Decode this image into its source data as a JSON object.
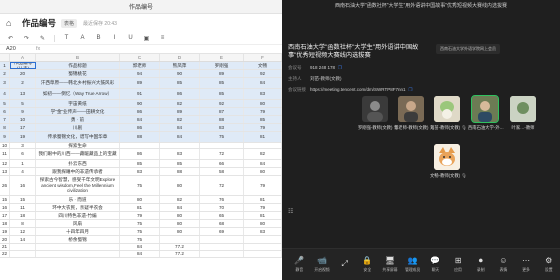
{
  "sheet": {
    "window_title": "作品编号",
    "doc_title": "作品编号",
    "doc_tag": "表格",
    "save_status": "最近保存 20:43",
    "cell_ref": "A20",
    "fx": "fx",
    "columns": [
      "",
      "A",
      "B",
      "C",
      "D",
      "E",
      "F"
    ],
    "rows": [
      {
        "n": "1",
        "a": "作品编号(从表)",
        "b": "作品标题",
        "c": "郭老师",
        "d": "熊凤萍",
        "e": "罗刚强",
        "f": "文畅",
        "h": 8,
        "sel": true,
        "hdr": true
      },
      {
        "n": "2",
        "a": "20",
        "b": "蜀锦桃花",
        "c": "94",
        "d": "90",
        "e": "89",
        "f": "92",
        "h": 8,
        "sel": true
      },
      {
        "n": "3",
        "a": "2",
        "b": "汗西草原——韩北乡村振兴大鼓风彩",
        "c": "89",
        "d": "85",
        "e": "85",
        "f": "84",
        "h": 11,
        "sel": true
      },
      {
        "n": "4",
        "a": "13",
        "b": "如初——倒忆（Way True Arrow）",
        "c": "91",
        "d": "86",
        "e": "85",
        "f": "83",
        "h": 11,
        "sel": true
      },
      {
        "n": "5",
        "a": "5",
        "b": "宇宙黄纸",
        "c": "90",
        "d": "82",
        "e": "92",
        "f": "80",
        "h": 8,
        "sel": true
      },
      {
        "n": "6",
        "a": "9",
        "b": "学\"金\"业传声——田耕文化",
        "c": "86",
        "d": "89",
        "e": "87",
        "f": "79",
        "h": 8,
        "sel": true
      },
      {
        "n": "7",
        "a": "10",
        "b": "勇 · 前",
        "c": "84",
        "d": "82",
        "e": "88",
        "f": "85",
        "h": 8,
        "sel": true
      },
      {
        "n": "8",
        "a": "17",
        "b": "川剧",
        "c": "86",
        "d": "84",
        "e": "83",
        "f": "79",
        "h": 8,
        "sel": true
      },
      {
        "n": "9",
        "a": "19",
        "b": "传承蜀锦文化，谱写中国华章",
        "c": "88",
        "d": "84",
        "e": "75",
        "f": "81",
        "h": 11,
        "sel": true
      },
      {
        "n": "10",
        "a": "3",
        "b": "探索生命",
        "c": "",
        "d": "",
        "e": "",
        "f": "",
        "h": 6
      },
      {
        "n": "11",
        "a": "6",
        "b": "我们眼中的川西——藏暖藏品上的宝藏",
        "c": "86",
        "d": "83",
        "e": "72",
        "f": "82",
        "h": 11
      },
      {
        "n": "12",
        "a": "1",
        "b": "扑云东西",
        "c": "85",
        "d": "85",
        "e": "66",
        "f": "84",
        "h": 8
      },
      {
        "n": "13",
        "a": "4",
        "b": "跟我探睡中的非遗传承者",
        "c": "83",
        "d": "88",
        "e": "58",
        "f": "80",
        "h": 8
      },
      {
        "n": "26",
        "a": "16",
        "b": "探索古今智慧，感受千年文明Explore ancient wisdom,Feel the Millennium civilization",
        "c": "75",
        "d": "80",
        "e": "72",
        "f": "79",
        "h": 20
      },
      {
        "n": "15",
        "a": "15",
        "b": "乐 · 而道",
        "c": "80",
        "d": "82",
        "e": "76",
        "f": "81",
        "h": 8
      },
      {
        "n": "16",
        "a": "11",
        "b": "环中大农民，亲疑半农会",
        "c": "81",
        "d": "84",
        "e": "70",
        "f": "79",
        "h": 8
      },
      {
        "n": "17",
        "a": "18",
        "b": "四川特色非遗-竹编",
        "c": "79",
        "d": "80",
        "e": "65",
        "f": "81",
        "h": 8
      },
      {
        "n": "18",
        "a": "8",
        "b": "风扇",
        "c": "75",
        "d": "80",
        "e": "68",
        "f": "80",
        "h": 8
      },
      {
        "n": "19",
        "a": "12",
        "b": "十四年四月",
        "c": "75",
        "d": "80",
        "e": "69",
        "f": "83",
        "h": 8
      },
      {
        "n": "20",
        "a": "14",
        "b": "桥余蜀锦",
        "c": "75",
        "d": "",
        "e": "",
        "f": "",
        "h": 8
      },
      {
        "n": "21",
        "a": "",
        "b": "",
        "c": "84",
        "d": "77.2",
        "e": "",
        "f": "",
        "h": 7
      },
      {
        "n": "22",
        "a": "",
        "b": "",
        "c": "84",
        "d": "77.2",
        "e": "",
        "f": "",
        "h": 7
      }
    ]
  },
  "meeting": {
    "window_title": "西南石油大学\"函数社杯\"大学生\"用外语讲中国故事\"优秀短视频大赛线内选拔赛",
    "notice": "西南石油大学外语学院网上会员",
    "title": "西南石油大学\"函数社杯\"大学生\"用外语讲中国故事\"优秀短视频大赛线内选拔赛",
    "info": [
      {
        "k": "会议号",
        "v": "918 248 178"
      },
      {
        "k": "主持人",
        "v": "刘苗-教师(文教)"
      },
      {
        "k": "会议链接",
        "v": "https://meeting.tencent.com/dm/SWRTP8F7nn1"
      }
    ],
    "tiles": [
      {
        "name": "罗刚强-教师(文教)",
        "active": false
      },
      {
        "name": "郭老师-教师(文教)",
        "active": false
      },
      {
        "name": "刘苗-教师(文教)",
        "active": false
      },
      {
        "name": "西南石油大学-外…",
        "active": true
      },
      {
        "name": "叶家…-教师",
        "active": false
      },
      {
        "name": "文畅-教师(文教)",
        "active": false
      }
    ],
    "dock": [
      {
        "icon": "🎤",
        "label": "静音"
      },
      {
        "icon": "📹",
        "label": "开启视频"
      },
      {
        "icon": "⤢",
        "label": ""
      },
      {
        "icon": "🔒",
        "label": "安全"
      },
      {
        "icon": "🖥",
        "label": "共享屏幕"
      },
      {
        "icon": "👥",
        "label": "管理成员"
      },
      {
        "icon": "💬",
        "label": "聊天"
      },
      {
        "icon": "⊞",
        "label": "应用"
      },
      {
        "icon": "⏺",
        "label": "录制"
      },
      {
        "icon": "☺",
        "label": "表情"
      },
      {
        "icon": "⋯",
        "label": "更多"
      },
      {
        "icon": "⚙",
        "label": "设置"
      }
    ]
  },
  "colors": {
    "sheet_selection": "#dfeaf7",
    "meeting_bg": "#1f1f1f",
    "active_speaker": "#2fc15f",
    "link_blue": "#3b7cf0"
  }
}
